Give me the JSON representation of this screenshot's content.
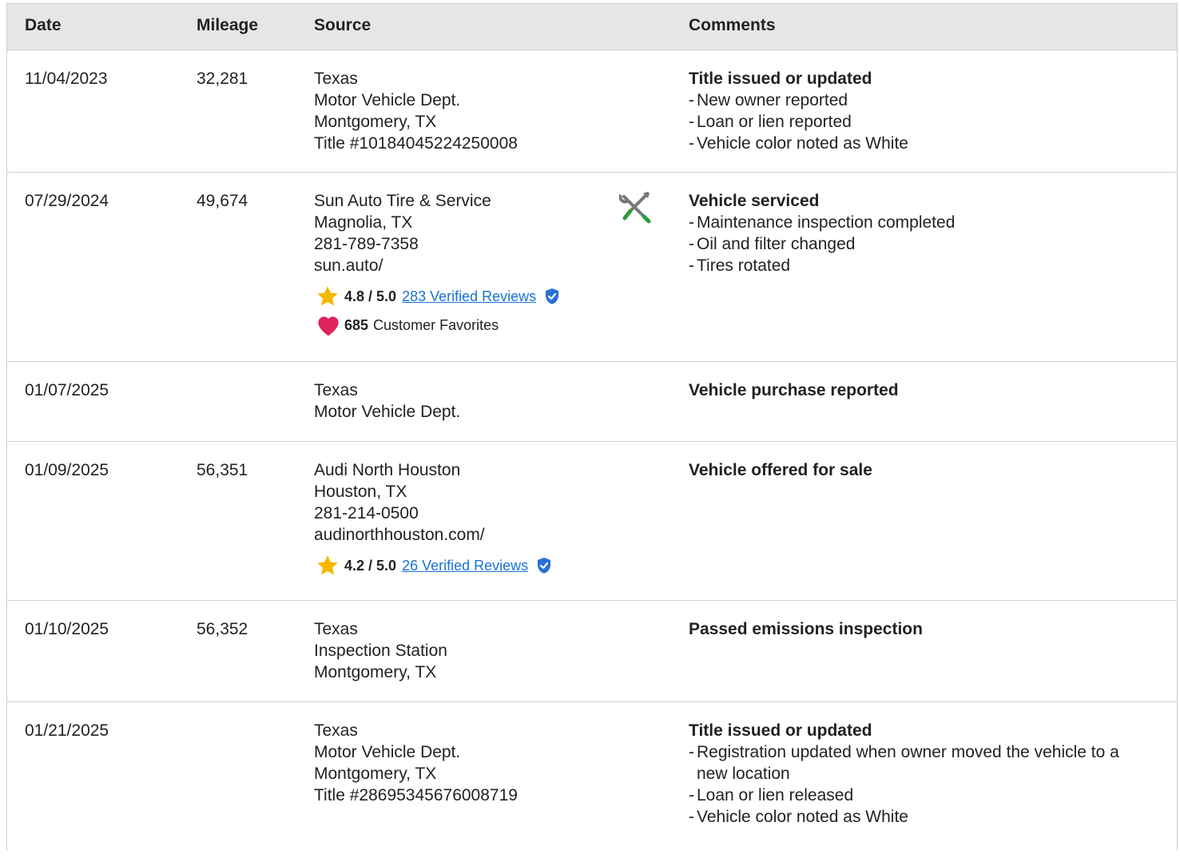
{
  "headers": {
    "date": "Date",
    "mileage": "Mileage",
    "source": "Source",
    "comments": "Comments"
  },
  "records": [
    {
      "date": "11/04/2023",
      "mileage": "32,281",
      "source": [
        "Texas",
        "Motor Vehicle Dept.",
        "Montgomery, TX",
        "Title #10184045224250008"
      ],
      "comment_title": "Title issued or updated",
      "comments": [
        "New owner reported",
        "Loan or lien reported",
        "Vehicle color noted as White"
      ]
    },
    {
      "date": "07/29/2024",
      "mileage": "49,674",
      "source": [
        "Sun Auto Tire & Service",
        "Magnolia, TX",
        "281-789-7358",
        "sun.auto/"
      ],
      "rating": {
        "score": "4.8 / 5.0",
        "reviews": "283 Verified Reviews"
      },
      "favorites": {
        "count": "685",
        "label": "Customer Favorites"
      },
      "icon": "wrench-screwdriver-icon",
      "comment_title": "Vehicle serviced",
      "comments": [
        "Maintenance inspection completed",
        "Oil and filter changed",
        "Tires rotated"
      ]
    },
    {
      "date": "01/07/2025",
      "mileage": "",
      "source": [
        "Texas",
        "Motor Vehicle Dept."
      ],
      "comment_title": "Vehicle purchase reported",
      "comments": []
    },
    {
      "date": "01/09/2025",
      "mileage": "56,351",
      "source": [
        "Audi North Houston",
        "Houston, TX",
        "281-214-0500",
        "audinorthhouston.com/"
      ],
      "rating": {
        "score": "4.2 / 5.0",
        "reviews": "26 Verified Reviews"
      },
      "comment_title": "Vehicle offered for sale",
      "comments": []
    },
    {
      "date": "01/10/2025",
      "mileage": "56,352",
      "source": [
        "Texas",
        "Inspection Station",
        "Montgomery, TX"
      ],
      "comment_title": "Passed emissions inspection",
      "comments": []
    },
    {
      "date": "01/21/2025",
      "mileage": "",
      "source": [
        "Texas",
        "Motor Vehicle Dept.",
        "Montgomery, TX",
        "Title #28695345676008719"
      ],
      "comment_title": "Title issued or updated",
      "comments": [
        "Registration updated when owner moved the vehicle to a new location",
        "Loan or lien released",
        "Vehicle color noted as White"
      ]
    }
  ],
  "colors": {
    "header_bg": "#e6e6e6",
    "link": "#1a73d8",
    "star": "#f5b800",
    "heart": "#e0245e",
    "shield": "#2a6fd6",
    "wrench": "#777777",
    "screwdriver_tip": "#2e9b3e"
  }
}
